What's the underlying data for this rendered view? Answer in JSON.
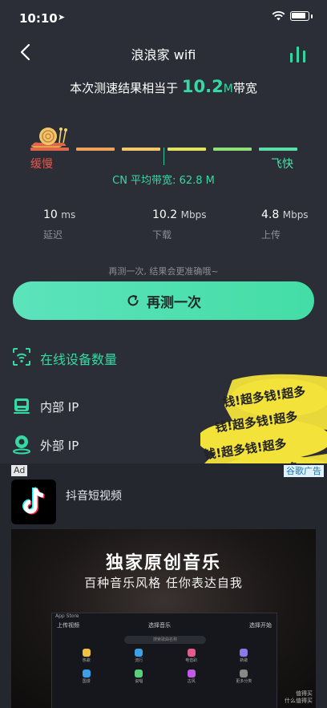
{
  "status": {
    "time": "10:10",
    "location_glyph": "➤"
  },
  "nav": {
    "title": "浪浪家 wifi",
    "back_icon": "chevron-left-icon",
    "stats_icon": "bar-chart-icon"
  },
  "headline": {
    "prefix": "本次测速结果相当于",
    "value": "10.2",
    "unit": "M",
    "suffix": "带宽"
  },
  "scale": {
    "slow_label": "缓慢",
    "fast_label": "飞快",
    "average": "CN 平均带宽: 62.8 M",
    "segments": [
      "#e0674a",
      "#efa25a",
      "#f3c76a",
      "#e3e25f",
      "#8fe07a",
      "#58dea6"
    ]
  },
  "metrics": [
    {
      "value": "10",
      "unit": "ms",
      "label": "延迟"
    },
    {
      "value": "10.2",
      "unit": "Mbps",
      "label": "下载"
    },
    {
      "value": "4.8",
      "unit": "Mbps",
      "label": "上传"
    }
  ],
  "retest": {
    "hint": "再测一次, 结果会更准确哦~",
    "button": "再测一次"
  },
  "rows": {
    "devices": "在线设备数量",
    "internal_ip": "内部 IP",
    "external_ip": "外部 IP"
  },
  "sticker": {
    "text": "钱!超多钱!超多",
    "color": "#f2e23a"
  },
  "ad": {
    "badge": "Ad",
    "provider": "谷歌广告",
    "app_name": "抖音短视频",
    "promo_title": "独家原创音乐",
    "promo_sub": "百种音乐风格 任你表达自我",
    "phone_top": "App Store",
    "phone_left": "上传视频",
    "phone_center": "选择音乐",
    "phone_right": "选择开始",
    "phone_search": "搜索歌曲名称",
    "grid": [
      {
        "label": "热歌",
        "color": "#f0c040"
      },
      {
        "label": "流行",
        "color": "#3aa0e8"
      },
      {
        "label": "电音趴",
        "color": "#e85a8a"
      },
      {
        "label": "新歌",
        "color": "#8a7ae8"
      },
      {
        "label": "国漫",
        "color": "#3aa0e8"
      },
      {
        "label": "说唱",
        "color": "#5ad07a"
      },
      {
        "label": "古风",
        "color": "#c05ae8"
      },
      {
        "label": "更多分类",
        "color": "#888888"
      }
    ],
    "watermark_line1": "值得买",
    "watermark_line2": "什么值得买"
  }
}
